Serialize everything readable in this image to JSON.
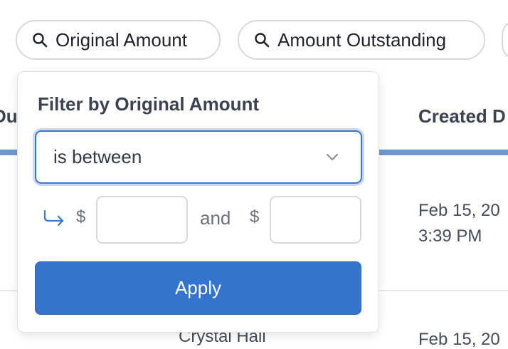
{
  "filters": {
    "chips": [
      {
        "label": "Original Amount",
        "icon": "search-icon"
      },
      {
        "label": "Amount Outstanding",
        "icon": "search-icon"
      }
    ]
  },
  "table": {
    "headers": {
      "left_partial": "Du",
      "created": "Created D"
    },
    "rows": [
      {
        "created": "Feb 15, 20",
        "created_time": "3:39 PM"
      },
      {
        "created": "Feb 15, 20",
        "name": "Crystal Hall"
      }
    ],
    "accent_color": "#6d98d4"
  },
  "popover": {
    "title": "Filter by Original Amount",
    "condition": {
      "value": "is between",
      "icon": "chevron-down-icon"
    },
    "range": {
      "arrow_icon": "return-arrow-icon",
      "currency": "$",
      "joiner": "and",
      "min_value": "",
      "max_value": ""
    },
    "apply_label": "Apply",
    "apply_color": "#3574cd",
    "focus_color": "#3a76c9"
  }
}
